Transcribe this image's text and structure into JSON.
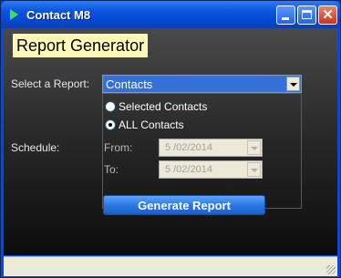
{
  "window": {
    "title": "Contact M8",
    "icon": "play-arrow-icon"
  },
  "colors": {
    "titlebar": "#0b56e0",
    "heading_bg": "#fff8b8",
    "selected_field": "#3470d8",
    "button": "#2b78e4"
  },
  "main": {
    "heading": "Report Generator",
    "report_label": "Select a Report:",
    "report_value": "Contacts",
    "options": [
      "Selected Contacts",
      "ALL Contacts"
    ],
    "selected_option": "ALL Contacts",
    "schedule_label": "Schedule:",
    "from_label": "From:",
    "from_value": "5 /02/2014",
    "to_label": "To:",
    "to_value": "5 /02/2014",
    "generate_button": "Generate Report"
  }
}
